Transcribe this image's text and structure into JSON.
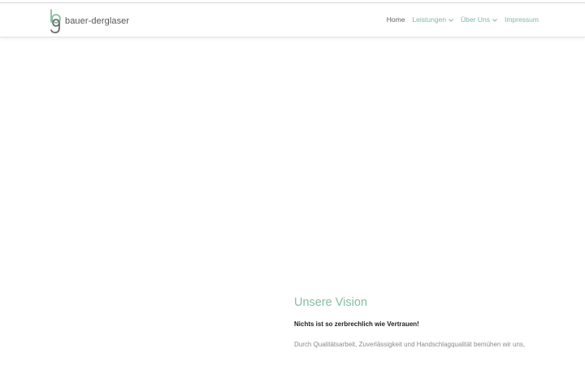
{
  "brand": {
    "name": "bauer-derglaser",
    "accent_color": "#85bea0",
    "logo_icon": "bg-monogram-icon"
  },
  "nav": {
    "items": [
      {
        "label": "Home",
        "active": true,
        "has_dropdown": false
      },
      {
        "label": "Leistungen",
        "active": false,
        "has_dropdown": true
      },
      {
        "label": "Über Uns",
        "active": false,
        "has_dropdown": true
      },
      {
        "label": "Impressum",
        "active": false,
        "has_dropdown": false
      }
    ]
  },
  "vision": {
    "title": "Unsere Vision",
    "subtitle": "Nichts ist so zerbrechlich wie Vertrauen!",
    "body": "Durch Qualitätsarbeit, Zuverlässigkeit und Handschlagqualität bemühen wir uns,"
  }
}
